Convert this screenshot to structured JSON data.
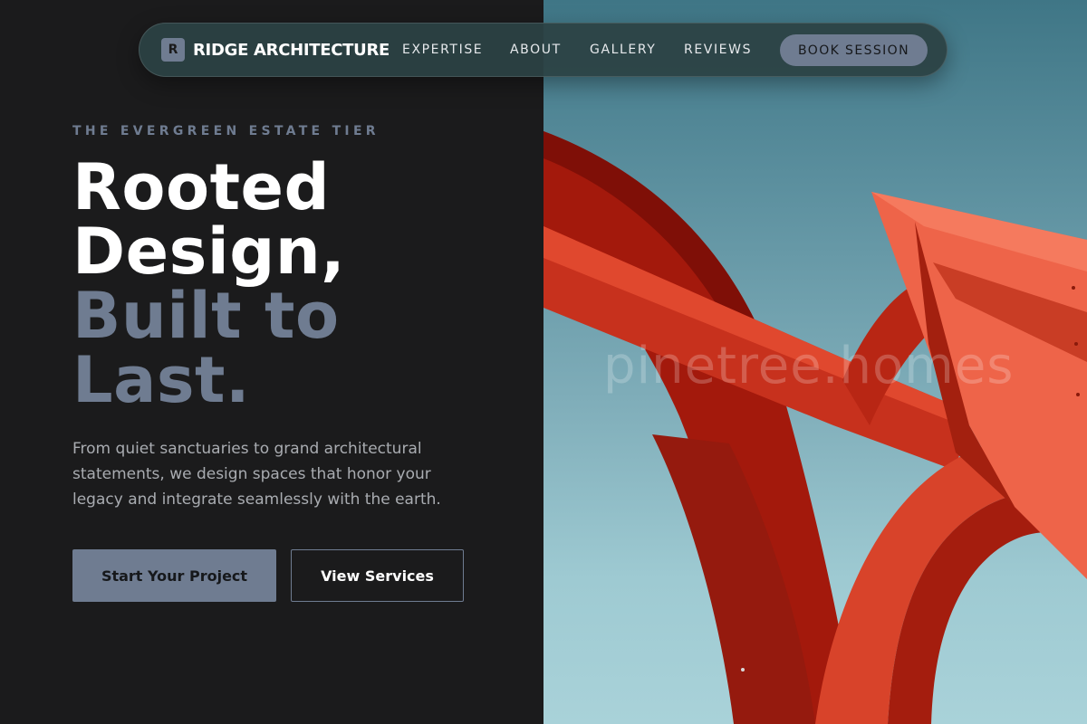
{
  "brand": {
    "mark": "R",
    "name": "RIDGE ARCHITECTURE"
  },
  "nav": {
    "links": [
      "EXPERTISE",
      "ABOUT",
      "GALLERY",
      "REVIEWS"
    ],
    "cta": "BOOK SESSION"
  },
  "hero": {
    "eyebrow": "THE EVERGREEN ESTATE TIER",
    "headline_lines": [
      "Rooted",
      "Design,",
      "Built to",
      "Last."
    ],
    "subcopy": "From quiet sanctuaries to grand architectural statements, we design spaces that honor your legacy and integrate seamlessly with the earth.",
    "primary_button": "Start Your Project",
    "secondary_button": "View Services"
  },
  "image": {
    "watermark": "pinetree.homes"
  },
  "colors": {
    "background": "#1b1b1c",
    "accent": "#6f7c91",
    "text": "#ffffff",
    "sculpture_red": "#c9351f"
  }
}
